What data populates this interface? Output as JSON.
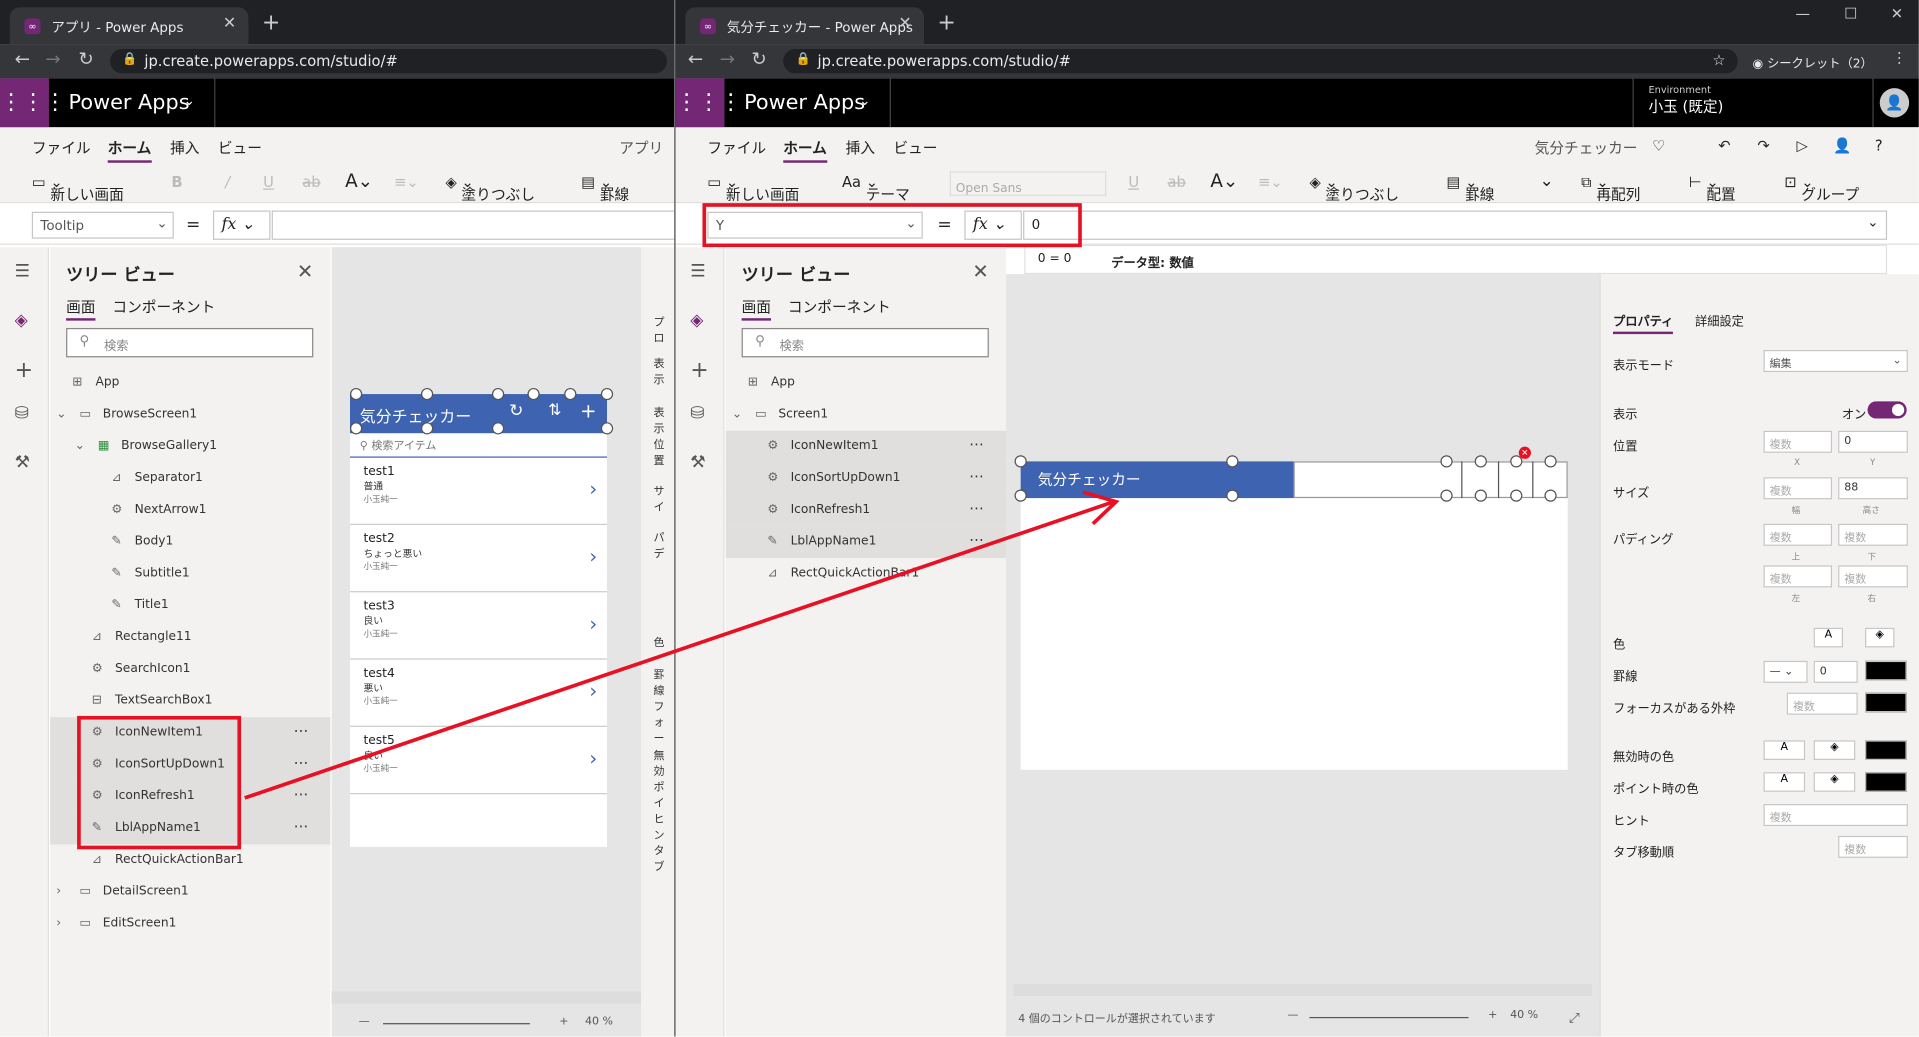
{
  "left": {
    "tab_title": "アプリ - Power Apps",
    "url": "jp.create.powerapps.com/studio/#",
    "brand": "Power Apps",
    "menu": [
      "ファイル",
      "ホーム",
      "挿入",
      "ビュー",
      "アプリ"
    ],
    "toolbar": {
      "new_screen": "新しい画面",
      "bold": "B",
      "fill": "塗りつぶし",
      "border": "罫線"
    },
    "property": "Tooltip",
    "tree_title": "ツリー ビュー",
    "tree_tabs": [
      "画面",
      "コンポーネント"
    ],
    "search_placeholder": "検索",
    "tree_nodes": [
      "App",
      "BrowseScreen1",
      "BrowseGallery1",
      "Separator1",
      "NextArrow1",
      "Body1",
      "Subtitle1",
      "Title1",
      "Rectangle11",
      "SearchIcon1",
      "TextSearchBox1",
      "IconNewItem1",
      "IconSortUpDown1",
      "IconRefresh1",
      "LblAppName1",
      "RectQuickActionBar1",
      "DetailScreen1",
      "EditScreen1"
    ],
    "gallery_title": "気分チェッカー",
    "gallery_search": "検索アイテム",
    "items": [
      {
        "title": "test1",
        "mood": "普通",
        "user": "小玉純一"
      },
      {
        "title": "test2",
        "mood": "ちょっと悪い",
        "user": "小玉純一"
      },
      {
        "title": "test3",
        "mood": "良い",
        "user": "小玉純一"
      },
      {
        "title": "test4",
        "mood": "悪い",
        "user": "小玉純一"
      },
      {
        "title": "test5",
        "mood": "良い",
        "user": "小玉純一"
      }
    ],
    "zoom": "40 %",
    "side_labels": [
      "プロ",
      "表示",
      "表示",
      "位置",
      "サイ",
      "パデ",
      "色",
      "罫線",
      "フォー",
      "無効",
      "ポイ",
      "ヒン",
      "タブ"
    ]
  },
  "right": {
    "tab_title": "気分チェッカー - Power Apps",
    "url": "jp.create.powerapps.com/studio/#",
    "incognito": "シークレット（2）",
    "brand": "Power Apps",
    "env_label": "Environment",
    "env_name": "小玉 (既定)",
    "menu": [
      "ファイル",
      "ホーム",
      "挿入",
      "ビュー"
    ],
    "app_name": "気分チェッカー",
    "toolbar": {
      "new_screen": "新しい画面",
      "theme": "テーマ",
      "font": "Open Sans",
      "fill": "塗りつぶし",
      "border": "罫線",
      "reorder": "再配列",
      "align": "配置",
      "group": "グループ"
    },
    "property": "Y",
    "formula": "0",
    "hint_expr": "0 = 0",
    "hint_type": "データ型: 数値",
    "tree_title": "ツリー ビュー",
    "tree_tabs": [
      "画面",
      "コンポーネント"
    ],
    "search_placeholder": "検索",
    "tree_nodes": [
      "App",
      "Screen1",
      "IconNewItem1",
      "IconSortUpDown1",
      "IconRefresh1",
      "LblAppName1",
      "RectQuickActionBar1"
    ],
    "header_title": "気分チェッカー",
    "status": "4 個のコントロールが選択されています",
    "zoom": "40 %",
    "props": {
      "tab_props": "プロパティ",
      "tab_adv": "詳細設定",
      "display_mode": "表示モード",
      "display_mode_val": "編集",
      "visible": "表示",
      "visible_val": "オン",
      "position": "位置",
      "size": "サイズ",
      "padding": "パディング",
      "multi": "複数",
      "pos_y": "0",
      "size_h": "88",
      "x": "X",
      "y": "Y",
      "w": "幅",
      "h": "高さ",
      "top": "上",
      "bottom": "下",
      "left": "左",
      "right": "右",
      "color": "色",
      "border": "罫線",
      "border_val": "0",
      "focus_border": "フォーカスがある外枠",
      "disabled_color": "無効時の色",
      "hover_color": "ポイント時の色",
      "hint": "ヒント",
      "tab_index": "タブ移動順"
    }
  }
}
